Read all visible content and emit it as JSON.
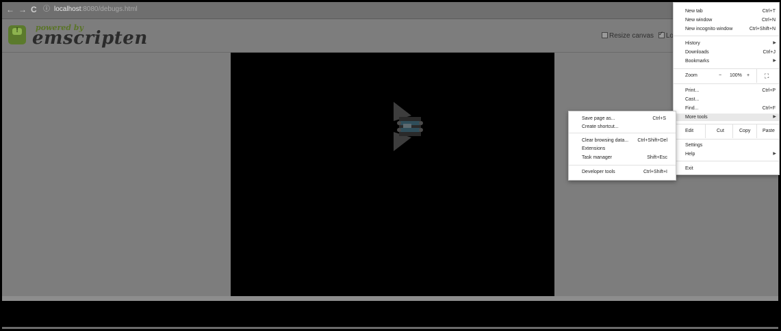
{
  "browser": {
    "url_host": "localhost",
    "url_rest": ":8080/debugs.html",
    "back_icon": "←",
    "forward_icon": "→",
    "reload_icon": "C",
    "info_icon": "ⓘ"
  },
  "header": {
    "powered_by": "powered by",
    "brand": "emscripten",
    "resize_label": "Resize canvas",
    "lock_label": "Lock"
  },
  "main_menu": {
    "items": [
      {
        "label": "New tab",
        "shortcut": "Ctrl+T"
      },
      {
        "label": "New window",
        "shortcut": "Ctrl+N"
      },
      {
        "label": "New incognito window",
        "shortcut": "Ctrl+Shift+N"
      },
      {
        "label": "History",
        "shortcut": ""
      },
      {
        "label": "Downloads",
        "shortcut": "Ctrl+J"
      },
      {
        "label": "Bookmarks",
        "shortcut": ""
      },
      {
        "label": "Print...",
        "shortcut": "Ctrl+P"
      },
      {
        "label": "Cast...",
        "shortcut": ""
      },
      {
        "label": "Find...",
        "shortcut": "Ctrl+F"
      },
      {
        "label": "More tools",
        "shortcut": ""
      },
      {
        "label": "Settings",
        "shortcut": ""
      },
      {
        "label": "Help",
        "shortcut": ""
      },
      {
        "label": "Exit",
        "shortcut": ""
      }
    ],
    "zoom": {
      "label": "Zoom",
      "minus": "−",
      "value": "100%",
      "plus": "+",
      "fullscreen": "⛶"
    },
    "edit": {
      "label": "Edit",
      "cut": "Cut",
      "copy": "Copy",
      "paste": "Paste"
    }
  },
  "sub_menu": {
    "items": [
      {
        "label": "Save page as...",
        "shortcut": "Ctrl+S"
      },
      {
        "label": "Create shortcut...",
        "shortcut": ""
      },
      {
        "label": "Clear browsing data...",
        "shortcut": "Ctrl+Shift+Del"
      },
      {
        "label": "Extensions",
        "shortcut": ""
      },
      {
        "label": "Task manager",
        "shortcut": "Shift+Esc"
      },
      {
        "label": "Developer tools",
        "shortcut": "Ctrl+Shift+I"
      }
    ]
  }
}
